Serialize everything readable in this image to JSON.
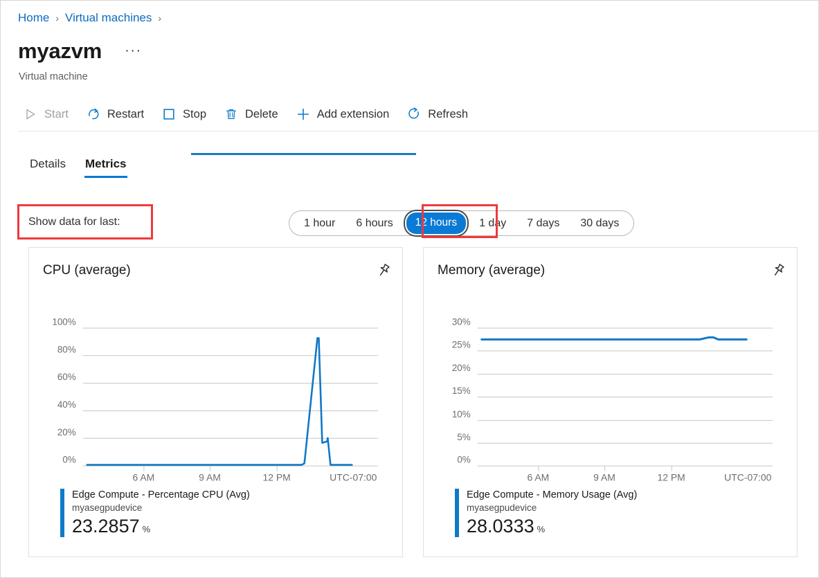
{
  "breadcrumb": {
    "items": [
      {
        "label": "Home"
      },
      {
        "label": "Virtual machines"
      }
    ],
    "separator": "›"
  },
  "header": {
    "title": "myazvm",
    "subtitle": "Virtual machine",
    "more_label": "···"
  },
  "commandbar": {
    "items": [
      {
        "label": "Start",
        "icon": "play-icon",
        "disabled": true
      },
      {
        "label": "Restart",
        "icon": "restart-icon",
        "disabled": false
      },
      {
        "label": "Stop",
        "icon": "stop-square-icon",
        "disabled": false
      },
      {
        "label": "Delete",
        "icon": "trash-icon",
        "disabled": false
      },
      {
        "label": "Add extension",
        "icon": "plus-icon",
        "disabled": false
      },
      {
        "label": "Refresh",
        "icon": "refresh-icon",
        "disabled": false
      }
    ]
  },
  "tabs": [
    {
      "label": "Details",
      "active": false
    },
    {
      "label": "Metrics",
      "active": true
    }
  ],
  "timerange": {
    "label": "Show data for last:",
    "options": [
      {
        "label": "1 hour",
        "selected": false
      },
      {
        "label": "6 hours",
        "selected": false
      },
      {
        "label": "12 hours",
        "selected": true
      },
      {
        "label": "1 day",
        "selected": false
      },
      {
        "label": "7 days",
        "selected": false
      },
      {
        "label": "30 days",
        "selected": false
      }
    ],
    "selected": "12 hours"
  },
  "colors": {
    "accent": "#0078d4",
    "series": "#1078c8",
    "annotation": "#f0393b",
    "link": "#0f6cbd",
    "gridline": "#c8c6c4"
  },
  "cards": [
    {
      "title": "CPU (average)",
      "pin_icon": "pin-icon",
      "legend": {
        "metric": "Edge Compute - Percentage CPU (Avg)",
        "device": "myasegpudevice",
        "value": "23.2857",
        "unit": "%"
      }
    },
    {
      "title": "Memory (average)",
      "pin_icon": "pin-icon",
      "legend": {
        "metric": "Edge Compute - Memory Usage (Avg)",
        "device": "myasegpudevice",
        "value": "28.0333",
        "unit": "%"
      }
    }
  ],
  "chart_data": [
    {
      "type": "line",
      "title": "CPU (average)",
      "xlabel": "",
      "ylabel": "",
      "ylim": [
        0,
        100
      ],
      "yticks": [
        0,
        20,
        40,
        60,
        80,
        100
      ],
      "ytick_labels": [
        "0%",
        "20%",
        "40%",
        "60%",
        "80%",
        "100%"
      ],
      "xtick_labels": [
        "6 AM",
        "9 AM",
        "12 PM"
      ],
      "timezone_label": "UTC-07:00",
      "grid": true,
      "legend_position": "bottom-left",
      "series": [
        {
          "name": "Edge Compute - Percentage CPU (Avg)",
          "device": "myasegpudevice",
          "color": "#1078c8",
          "current_value": 23.2857,
          "unit": "%",
          "x": [
            0,
            10,
            20,
            30,
            40,
            50,
            60,
            70,
            75,
            77,
            79,
            81,
            84,
            86,
            89,
            91,
            94,
            100
          ],
          "values": [
            1,
            1,
            1,
            1,
            1,
            1,
            1,
            1,
            1,
            1,
            5,
            88,
            88,
            17,
            18,
            20,
            1,
            1
          ]
        }
      ]
    },
    {
      "type": "line",
      "title": "Memory (average)",
      "xlabel": "",
      "ylabel": "",
      "ylim": [
        0,
        30
      ],
      "yticks": [
        0,
        5,
        10,
        15,
        20,
        25,
        30
      ],
      "ytick_labels": [
        "0%",
        "5%",
        "10%",
        "15%",
        "20%",
        "25%",
        "30%"
      ],
      "xtick_labels": [
        "6 AM",
        "9 AM",
        "12 PM"
      ],
      "timezone_label": "UTC-07:00",
      "grid": true,
      "legend_position": "bottom-left",
      "series": [
        {
          "name": "Edge Compute - Memory Usage (Avg)",
          "device": "myasegpudevice",
          "color": "#1078c8",
          "current_value": 28.0333,
          "unit": "%",
          "x": [
            0,
            15,
            30,
            45,
            60,
            72,
            78,
            82,
            86,
            90,
            95,
            100
          ],
          "values": [
            27.3,
            27.3,
            27.3,
            27.3,
            27.3,
            27.3,
            27.4,
            27.9,
            27.4,
            27.3,
            27.3,
            27.3
          ]
        }
      ]
    }
  ]
}
